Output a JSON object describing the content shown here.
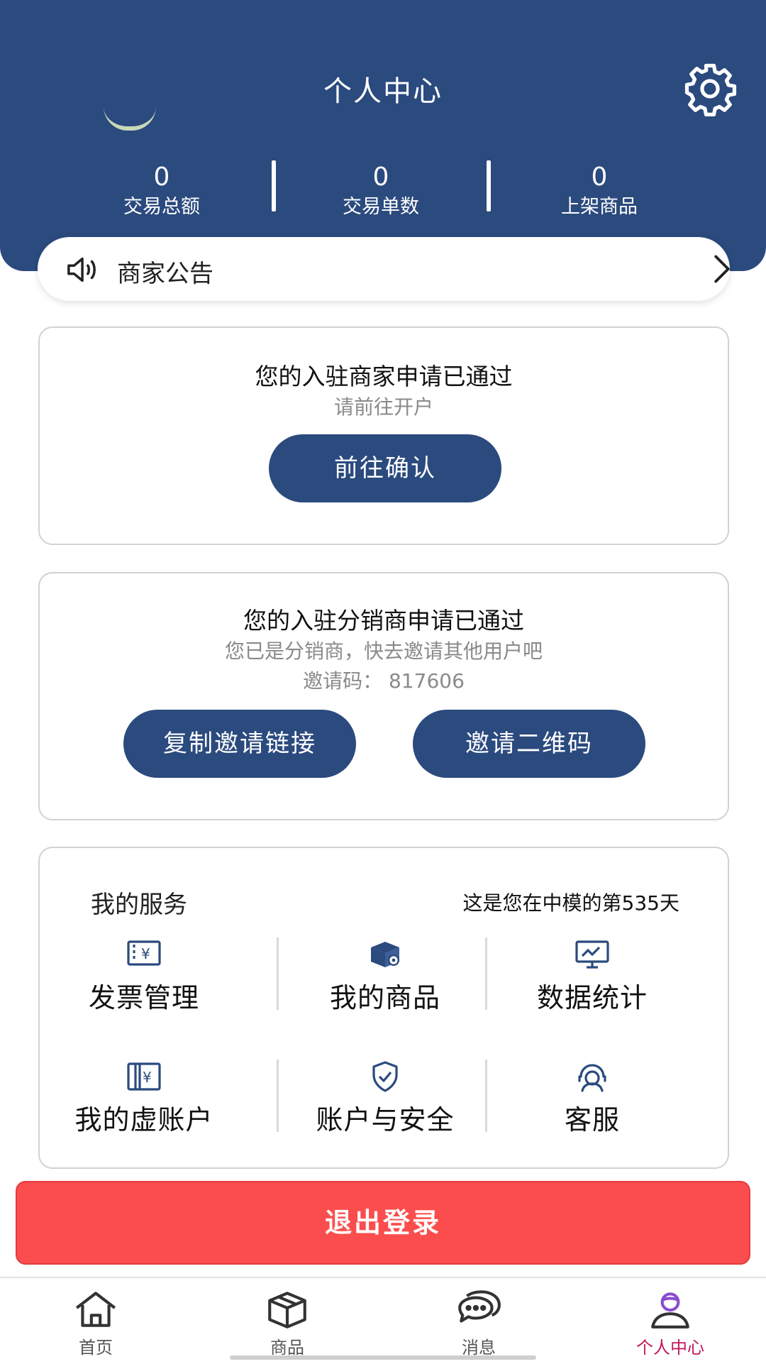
{
  "header": {
    "title": "个人中心",
    "stats": [
      {
        "value": "0",
        "label": "交易总额"
      },
      {
        "value": "0",
        "label": "交易单数"
      },
      {
        "value": "0",
        "label": "上架商品"
      }
    ]
  },
  "notice": {
    "label": "商家公告"
  },
  "merchant_card": {
    "title": "您的入驻商家申请已通过",
    "subtitle": "请前往开户",
    "button": "前往确认"
  },
  "distributor_card": {
    "title": "您的入驻分销商申请已通过",
    "subtitle": "您已是分销商，快去邀请其他用户吧",
    "invite_code": "邀请码：  817606",
    "copy_button": "复制邀请链接",
    "qr_button": "邀请二维码"
  },
  "services": {
    "title": "我的服务",
    "days_text": "这是您在中模的第535天",
    "items": [
      {
        "label": "发票管理",
        "icon": "invoice-icon"
      },
      {
        "label": "我的商品",
        "icon": "product-box-icon"
      },
      {
        "label": "数据统计",
        "icon": "chart-monitor-icon"
      },
      {
        "label": "我的虚账户",
        "icon": "virtual-account-icon"
      },
      {
        "label": "账户与安全",
        "icon": "shield-check-icon"
      },
      {
        "label": "客服",
        "icon": "customer-service-icon"
      }
    ]
  },
  "logout": {
    "label": "退出登录"
  },
  "tabbar": {
    "items": [
      {
        "label": "首页",
        "icon": "home-icon"
      },
      {
        "label": "商品",
        "icon": "box-icon"
      },
      {
        "label": "消息",
        "icon": "chat-icon"
      },
      {
        "label": "个人中心",
        "icon": "user-icon"
      }
    ],
    "active_color": "#c2185b"
  },
  "colors": {
    "primary": "#2b4a7e",
    "danger": "#fb4d4d"
  }
}
